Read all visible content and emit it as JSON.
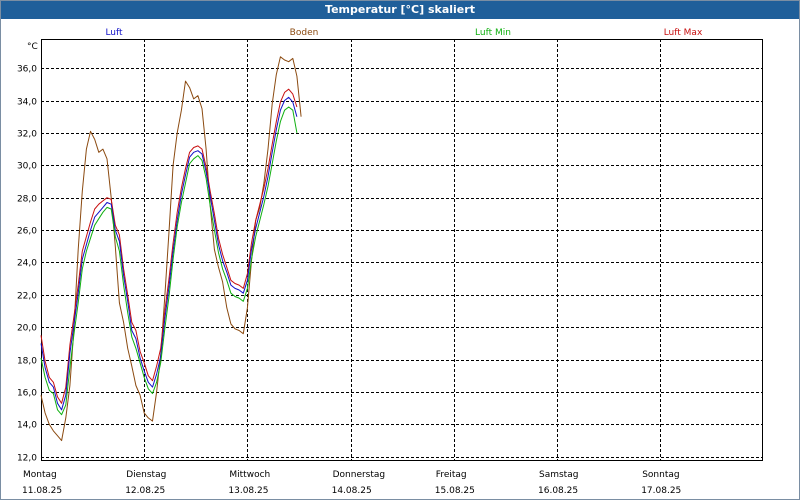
{
  "window": {
    "title": "Temperatur [°C] skaliert"
  },
  "chart_data": {
    "type": "line",
    "title": "Temperatur [°C] skaliert",
    "ylabel": "°C",
    "xlabel": "",
    "ylim": [
      11.8,
      37.8
    ],
    "yticks": [
      12.0,
      14.0,
      16.0,
      18.0,
      20.0,
      22.0,
      24.0,
      26.0,
      28.0,
      30.0,
      32.0,
      34.0,
      36.0
    ],
    "ytick_labels": [
      "12,0",
      "14,0",
      "16,0",
      "18,0",
      "20,0",
      "22,0",
      "24,0",
      "26,0",
      "28,0",
      "30,0",
      "32,0",
      "34,0",
      "36,0"
    ],
    "xlim": [
      0,
      7
    ],
    "grid": true,
    "legend_position": "top",
    "days": [
      {
        "weekday": "Montag",
        "date": "11.08.25"
      },
      {
        "weekday": "Dienstag",
        "date": "12.08.25"
      },
      {
        "weekday": "Mittwoch",
        "date": "13.08.25"
      },
      {
        "weekday": "Donnerstag",
        "date": "14.08.25"
      },
      {
        "weekday": "Freitag",
        "date": "15.08.25"
      },
      {
        "weekday": "Samstag",
        "date": "16.08.25"
      },
      {
        "weekday": "Sonntag",
        "date": "17.08.25"
      }
    ],
    "x": [
      0.0,
      0.04,
      0.08,
      0.12,
      0.16,
      0.2,
      0.24,
      0.28,
      0.32,
      0.36,
      0.4,
      0.44,
      0.48,
      0.52,
      0.56,
      0.6,
      0.64,
      0.68,
      0.72,
      0.76,
      0.8,
      0.84,
      0.88,
      0.92,
      0.96,
      1.0,
      1.04,
      1.08,
      1.12,
      1.16,
      1.2,
      1.24,
      1.28,
      1.32,
      1.36,
      1.4,
      1.44,
      1.48,
      1.52,
      1.56,
      1.6,
      1.64,
      1.68,
      1.72,
      1.76,
      1.8,
      1.84,
      1.88,
      1.92,
      1.96,
      2.0,
      2.04,
      2.08,
      2.12,
      2.16,
      2.2,
      2.24,
      2.28,
      2.32,
      2.36,
      2.4,
      2.44,
      2.48,
      2.52,
      2.56,
      2.6,
      2.64,
      2.68,
      2.72,
      2.76,
      2.8
    ],
    "series": [
      {
        "name": "Luft",
        "color": "#1010c8",
        "values": [
          19.0,
          17.5,
          16.6,
          16.3,
          15.3,
          14.9,
          15.8,
          18.4,
          20.2,
          22.1,
          24.2,
          25.1,
          26.0,
          26.8,
          27.1,
          27.4,
          27.7,
          27.6,
          26.0,
          25.3,
          23.2,
          21.6,
          19.8,
          19.3,
          18.1,
          17.3,
          16.6,
          16.3,
          17.1,
          18.2,
          20.5,
          22.5,
          24.7,
          26.6,
          28.2,
          29.4,
          30.5,
          30.8,
          30.9,
          30.7,
          29.6,
          28.1,
          26.6,
          25.1,
          24.1,
          23.4,
          22.6,
          22.4,
          22.3,
          22.1,
          22.9,
          24.8,
          26.1,
          27.1,
          28.1,
          29.3,
          30.8,
          32.2,
          33.4,
          34.0,
          34.2,
          33.9,
          33.0
        ]
      },
      {
        "name": "Boden",
        "color": "#8b4a10",
        "values": [
          15.8,
          14.7,
          14.0,
          13.6,
          13.3,
          13.0,
          14.4,
          16.4,
          20.0,
          24.8,
          28.4,
          31.0,
          32.1,
          31.6,
          30.8,
          31.0,
          30.4,
          28.0,
          25.0,
          21.5,
          20.3,
          18.7,
          17.6,
          16.4,
          15.8,
          14.7,
          14.4,
          14.2,
          16.0,
          18.3,
          21.9,
          25.9,
          30.0,
          32.0,
          33.4,
          35.2,
          34.8,
          34.1,
          34.3,
          33.5,
          31.0,
          27.5,
          24.8,
          23.7,
          22.8,
          21.2,
          20.2,
          19.9,
          19.8,
          19.6,
          21.2,
          24.1,
          26.6,
          27.4,
          28.9,
          31.0,
          33.8,
          35.6,
          36.7,
          36.5,
          36.4,
          36.6,
          35.5,
          33.0
        ]
      },
      {
        "name": "Luft Min",
        "color": "#10b010",
        "values": [
          18.1,
          16.9,
          16.1,
          15.9,
          14.9,
          14.6,
          15.2,
          17.5,
          19.6,
          21.5,
          23.6,
          24.7,
          25.5,
          26.3,
          26.7,
          27.1,
          27.4,
          27.3,
          25.6,
          24.7,
          22.6,
          20.9,
          19.4,
          18.7,
          17.8,
          16.9,
          16.2,
          15.9,
          16.6,
          17.8,
          19.9,
          21.9,
          24.2,
          26.2,
          27.7,
          28.9,
          30.1,
          30.4,
          30.6,
          30.3,
          29.2,
          27.5,
          26.0,
          24.6,
          23.6,
          22.9,
          22.1,
          21.9,
          21.8,
          21.6,
          22.4,
          24.2,
          25.6,
          26.6,
          27.6,
          28.7,
          30.1,
          31.5,
          32.7,
          33.4,
          33.6,
          33.4,
          32.0
        ]
      },
      {
        "name": "Luft Max",
        "color": "#c81010",
        "values": [
          19.5,
          17.9,
          16.9,
          16.6,
          15.7,
          15.3,
          16.3,
          18.9,
          20.7,
          22.6,
          24.7,
          25.6,
          26.5,
          27.3,
          27.6,
          27.8,
          28.0,
          27.9,
          26.3,
          25.7,
          23.6,
          22.0,
          20.3,
          19.8,
          18.5,
          17.8,
          17.0,
          16.7,
          17.6,
          18.7,
          21.0,
          23.0,
          25.2,
          27.1,
          28.6,
          29.8,
          30.8,
          31.1,
          31.2,
          31.0,
          29.9,
          28.4,
          27.0,
          25.5,
          24.5,
          23.7,
          22.9,
          22.7,
          22.6,
          22.4,
          23.3,
          25.2,
          26.6,
          27.6,
          28.6,
          29.8,
          31.3,
          32.7,
          33.9,
          34.5,
          34.7,
          34.4,
          33.6
        ]
      }
    ]
  }
}
